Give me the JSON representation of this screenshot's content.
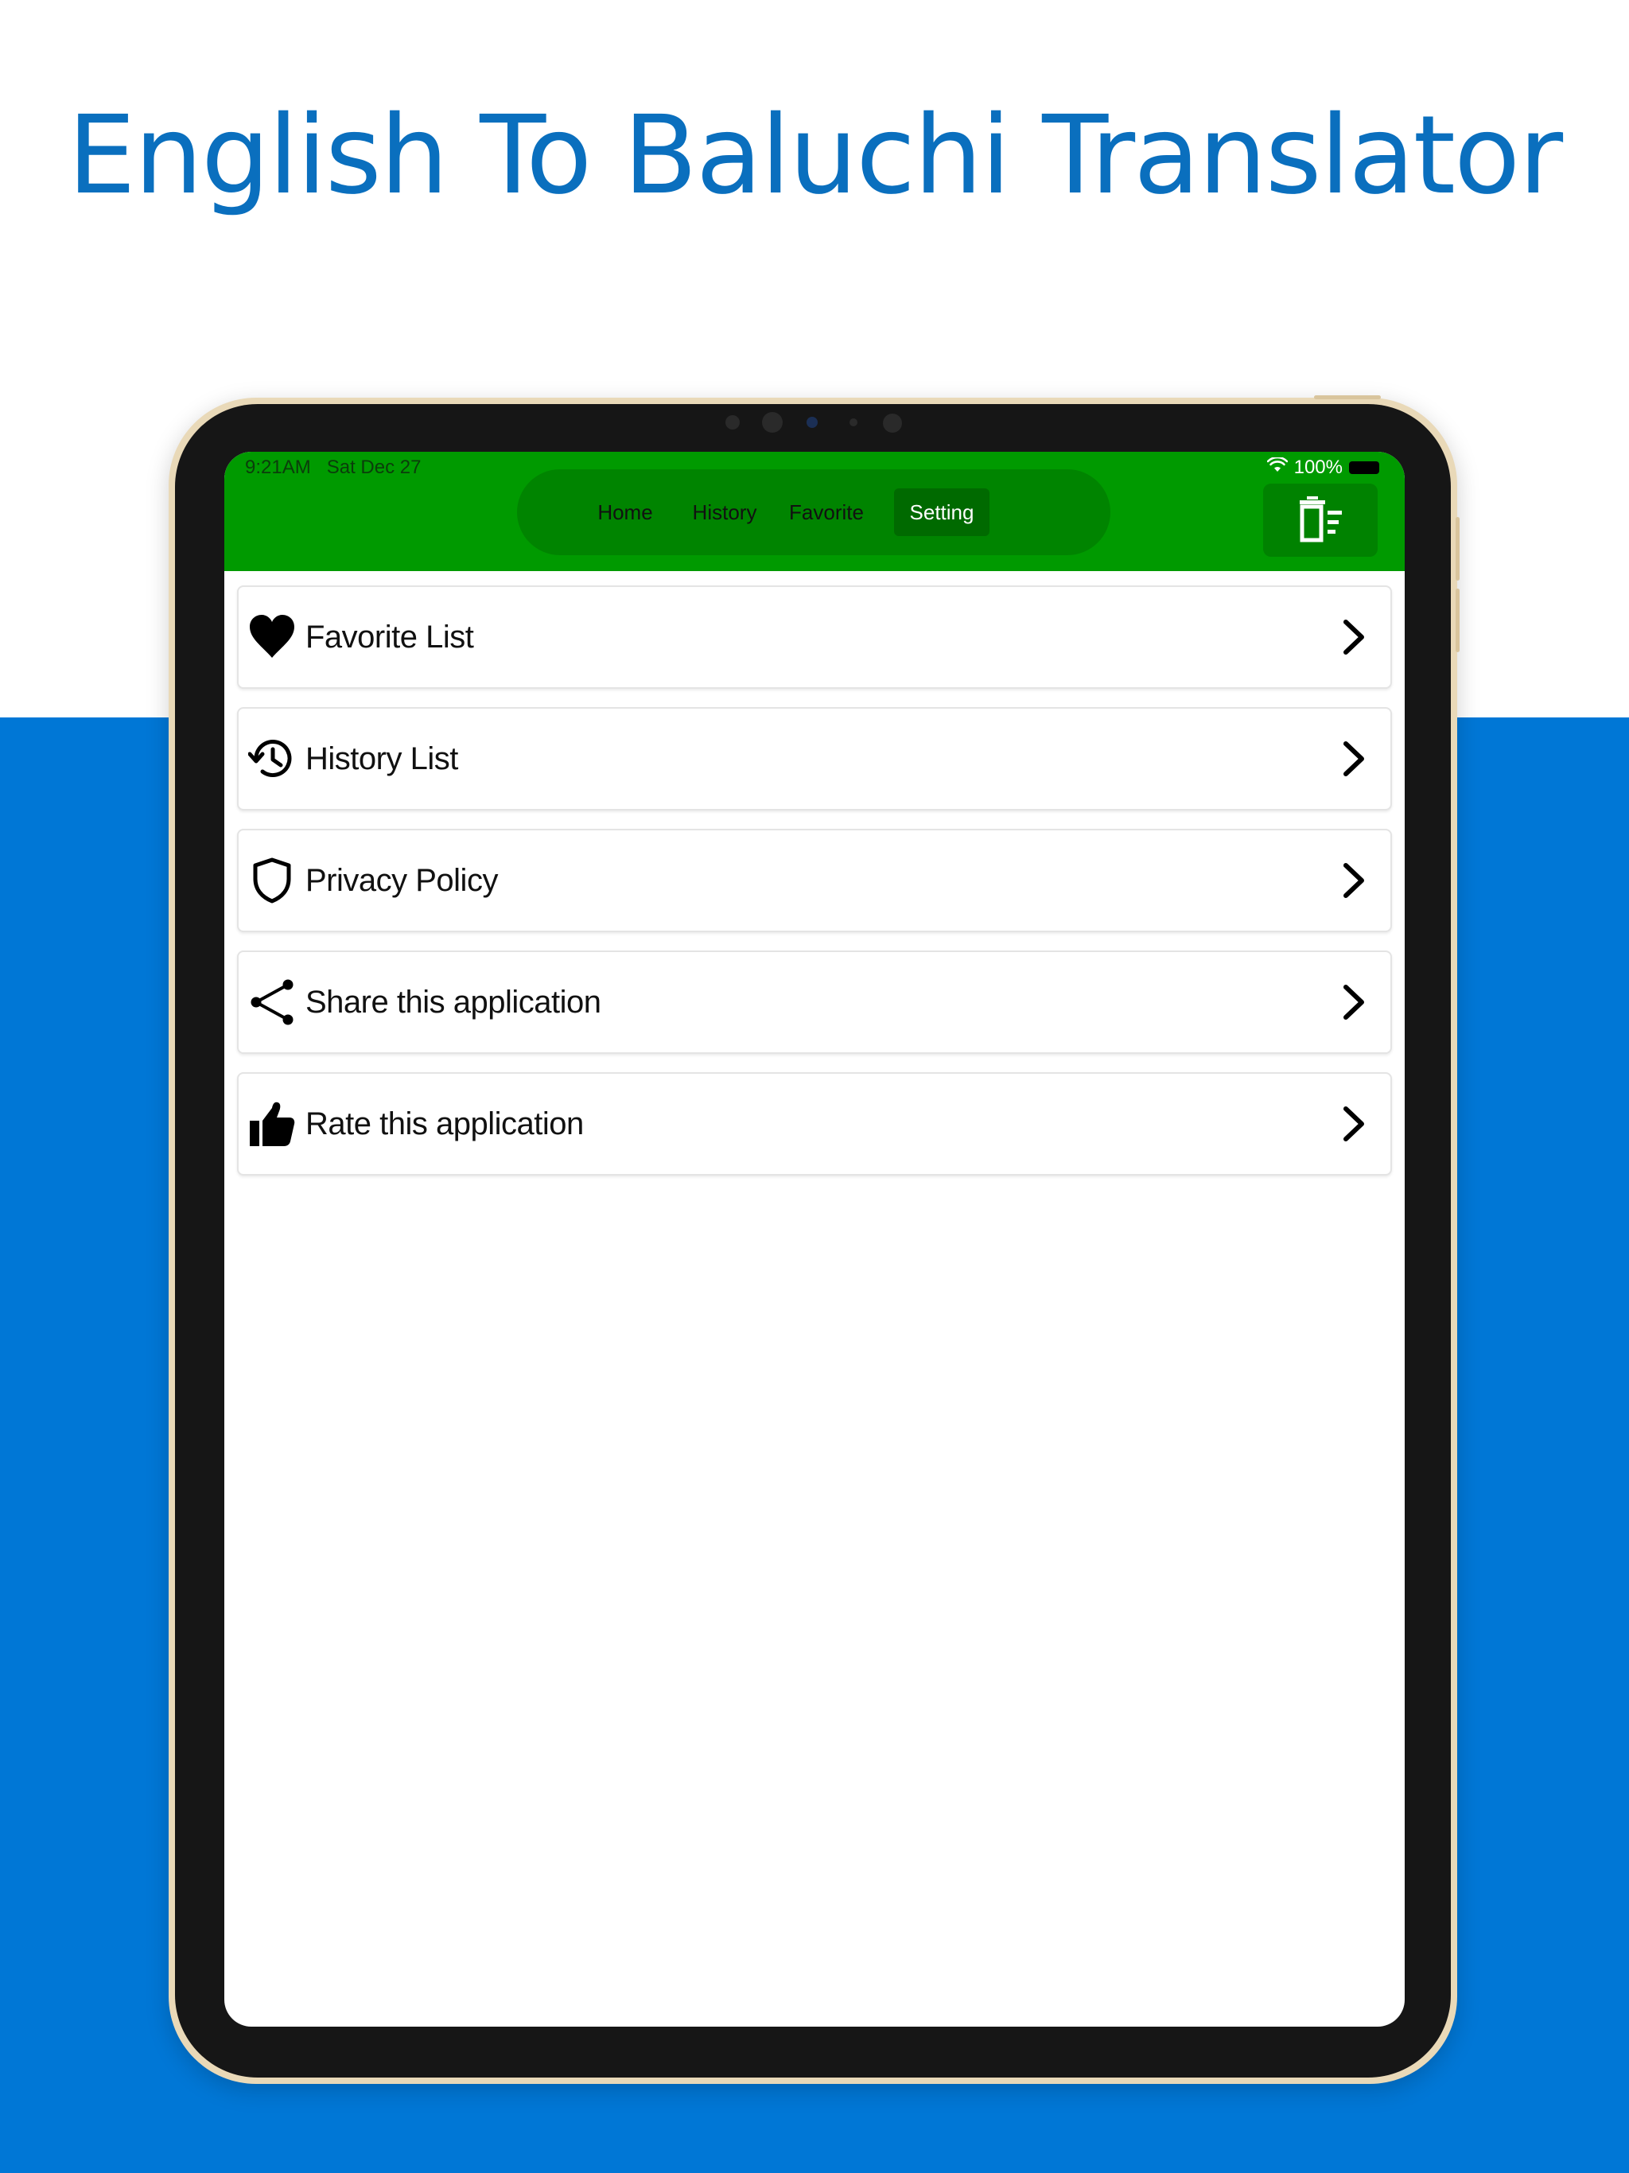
{
  "headline": "English To Baluchi Translator",
  "status_bar": {
    "time": "9:21AM   Sat Dec 27",
    "battery": "100%"
  },
  "tabs": [
    {
      "label": "Home",
      "active": false
    },
    {
      "label": "History",
      "active": false
    },
    {
      "label": "Favorite",
      "active": false
    },
    {
      "label": "Setting",
      "active": true
    }
  ],
  "header_action": {
    "icon": "delete-list-icon"
  },
  "settings": [
    {
      "label": "Favorite List",
      "icon": "heart-icon"
    },
    {
      "label": "History List",
      "icon": "history-icon"
    },
    {
      "label": "Privacy Policy",
      "icon": "shield-icon"
    },
    {
      "label": "Share this application",
      "icon": "share-icon"
    },
    {
      "label": "Rate this application",
      "icon": "thumbs-up-icon"
    }
  ],
  "colors": {
    "header_green": "#009a00",
    "brand_blue": "#0077d6",
    "headline_blue": "#0a6fbe"
  }
}
